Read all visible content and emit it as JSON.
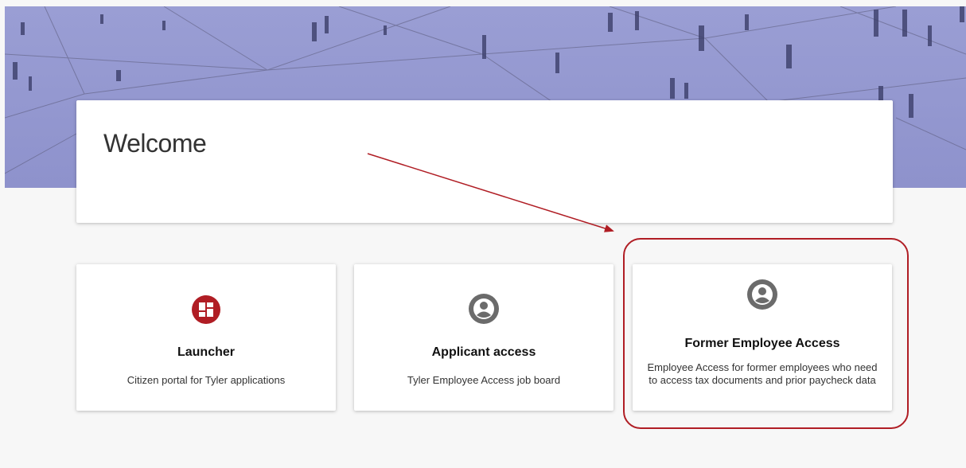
{
  "welcome": {
    "title": "Welcome"
  },
  "tiles": [
    {
      "title": "Launcher",
      "description": "Citizen portal for Tyler applications",
      "icon": "launcher-grid-icon",
      "color": "#b01d24"
    },
    {
      "title": "Applicant access",
      "description": "Tyler Employee Access job board",
      "icon": "account-circle-icon",
      "color": "#6b6b6b"
    },
    {
      "title": "Former Employee Access",
      "description": "Employee Access for former employees who need to access tax documents and prior paycheck data",
      "icon": "account-circle-icon",
      "color": "#6b6b6b"
    }
  ],
  "annotation": {
    "color": "#b01d24",
    "highlight": "rounded-rectangle",
    "arrow": "arrow"
  }
}
